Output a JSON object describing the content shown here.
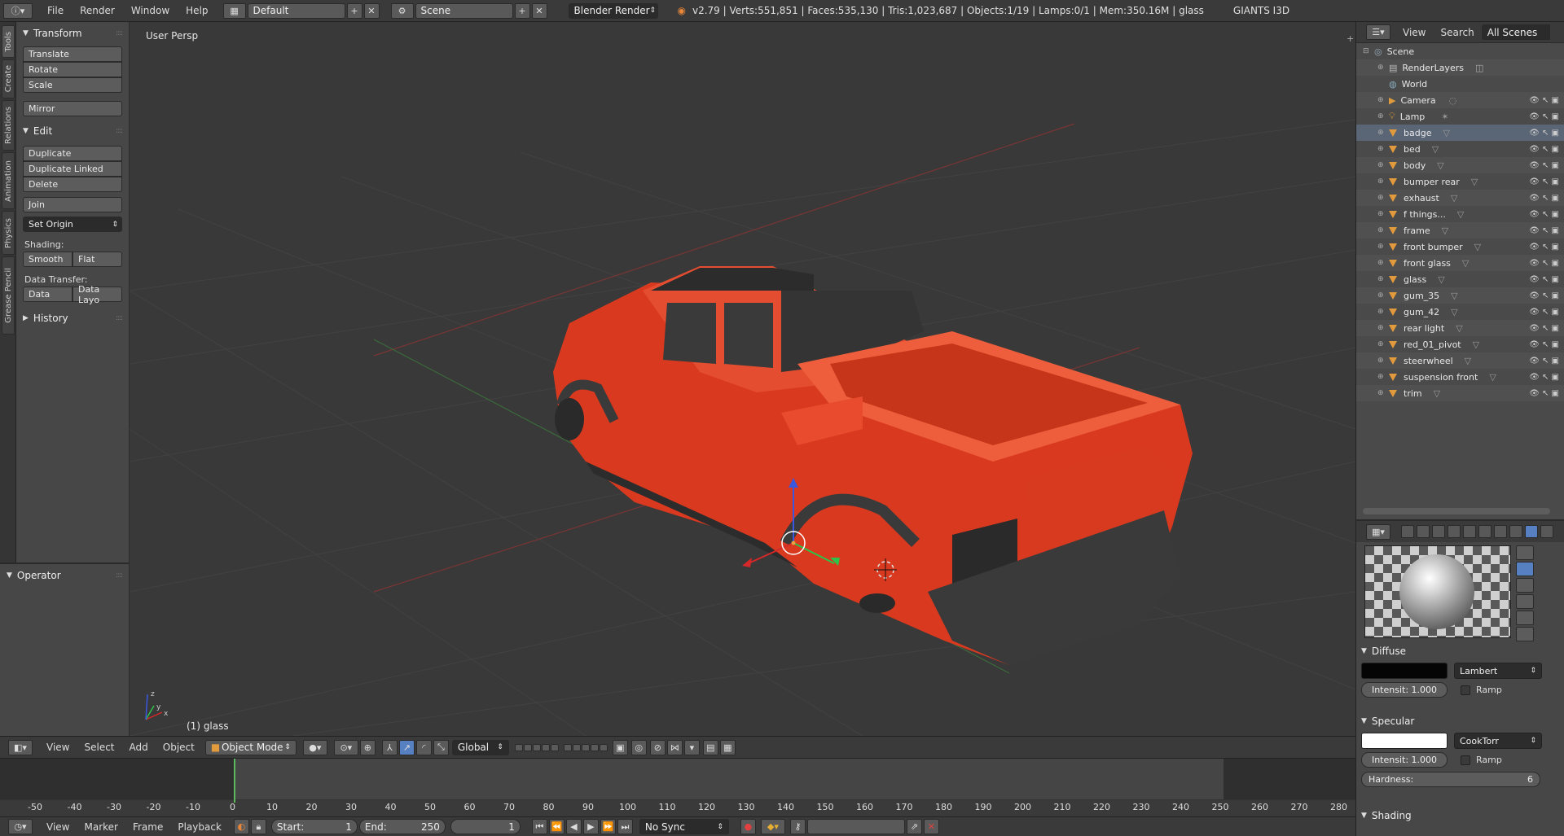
{
  "topbar": {
    "menu": [
      "File",
      "Render",
      "Window",
      "Help"
    ],
    "layout": "Default",
    "scene": "Scene",
    "engine": "Blender Render",
    "stats": "v2.79 | Verts:551,851 | Faces:535,130 | Tris:1,023,687 | Objects:1/19 | Lamps:0/1 | Mem:350.16M | glass",
    "plugin": "GIANTS I3D"
  },
  "tabs": [
    "Tools",
    "Create",
    "Relations",
    "Animation",
    "Physics",
    "Grease Pencil"
  ],
  "tools": {
    "transform_title": "Transform",
    "translate": "Translate",
    "rotate": "Rotate",
    "scale": "Scale",
    "mirror": "Mirror",
    "edit_title": "Edit",
    "duplicate": "Duplicate",
    "duplicate_linked": "Duplicate Linked",
    "delete": "Delete",
    "join": "Join",
    "set_origin": "Set Origin",
    "shading_label": "Shading:",
    "smooth": "Smooth",
    "flat": "Flat",
    "data_transfer_label": "Data Transfer:",
    "data": "Data",
    "data_layo": "Data Layo",
    "history_title": "History",
    "operator_title": "Operator"
  },
  "viewport": {
    "label": "User Persp",
    "object_label": "(1) glass",
    "truck_color": "#e8442a"
  },
  "view_header": {
    "menus": [
      "View",
      "Select",
      "Add",
      "Object"
    ],
    "mode": "Object Mode",
    "orientation": "Global"
  },
  "timeline": {
    "ticks": [
      "-50",
      "-40",
      "-30",
      "-20",
      "-10",
      "0",
      "10",
      "20",
      "30",
      "40",
      "50",
      "60",
      "70",
      "80",
      "90",
      "100",
      "110",
      "120",
      "130",
      "140",
      "150",
      "160",
      "170",
      "180",
      "190",
      "200",
      "210",
      "220",
      "230",
      "240",
      "250",
      "260",
      "270",
      "280"
    ]
  },
  "footer": {
    "menus": [
      "View",
      "Marker",
      "Frame",
      "Playback"
    ],
    "start_label": "Start:",
    "start_value": "1",
    "end_label": "End:",
    "end_value": "250",
    "current": "1",
    "sync": "No Sync"
  },
  "outliner": {
    "view": "View",
    "search": "Search",
    "scenes": "All Scenes",
    "scene": "Scene",
    "items": [
      "RenderLayers",
      "World",
      "Camera",
      "Lamp",
      "badge",
      "bed",
      "body",
      "bumper rear",
      "exhaust",
      "f things...",
      "frame",
      "front bumper",
      "front glass",
      "glass",
      "gum_35",
      "gum_42",
      "rear light",
      "red_01_pivot",
      "steerwheel",
      "suspension front",
      "trim"
    ]
  },
  "properties": {
    "diffuse_title": "Diffuse",
    "diffuse_color": "#050505",
    "diffuse_shader": "Lambert",
    "diffuse_intensity": "Intensit:  1.000",
    "ramp": "Ramp",
    "specular_title": "Specular",
    "specular_color": "#ffffff",
    "specular_shader": "CookTorr",
    "specular_intensity": "Intensit:  1.000",
    "hardness_label": "Hardness:",
    "hardness_value": "6",
    "shading_title": "Shading"
  }
}
